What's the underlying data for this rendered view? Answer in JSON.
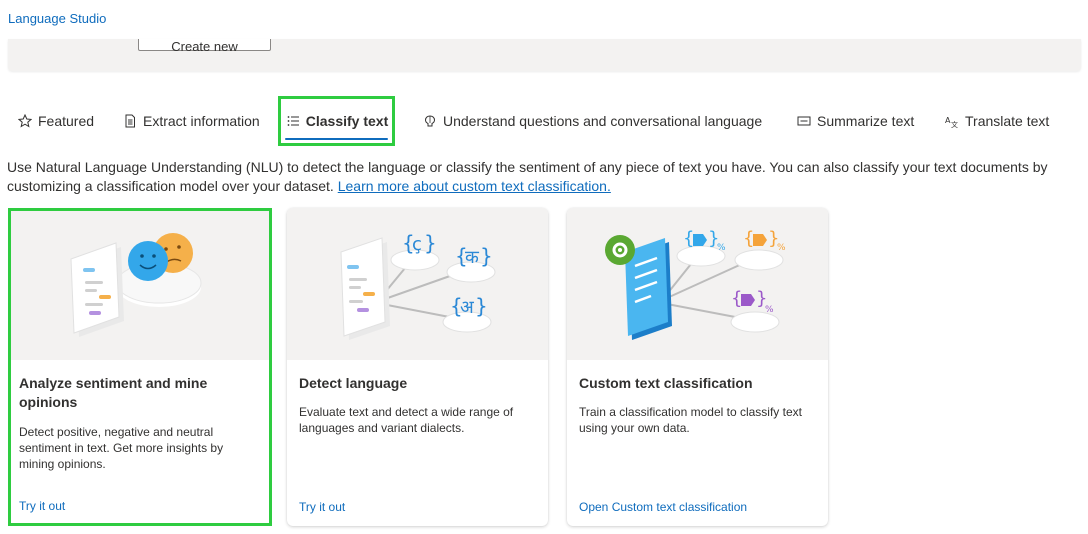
{
  "app": {
    "title": "Language Studio"
  },
  "top_panel": {
    "create_button": "Create new"
  },
  "tabs": [
    {
      "label": "Featured",
      "icon": "star-icon",
      "selected": false
    },
    {
      "label": "Extract information",
      "icon": "document-icon",
      "selected": false
    },
    {
      "label": "Classify text",
      "icon": "list-icon",
      "selected": true
    },
    {
      "label": "Understand questions and conversational language",
      "icon": "brain-icon",
      "selected": false
    },
    {
      "label": "Summarize text",
      "icon": "text-box-icon",
      "selected": false
    },
    {
      "label": "Translate text",
      "icon": "translate-icon",
      "selected": false
    }
  ],
  "description": {
    "text": "Use Natural Language Understanding (NLU) to detect the language or classify the sentiment of any piece of text you have. You can also classify your text documents by customizing a classification model over your dataset.",
    "link": "Learn more about custom text classification."
  },
  "cards": [
    {
      "title": "Analyze sentiment and mine opinions",
      "description": "Detect positive, negative and neutral sentiment in text. Get more insights by mining opinions.",
      "link": "Try it out",
      "illustration": "sentiment-faces-illustration"
    },
    {
      "title": "Detect language",
      "description": "Evaluate text and detect a wide range of languages and variant dialects.",
      "link": "Try it out",
      "illustration": "language-glyphs-illustration",
      "glyphs": [
        "ç",
        "क",
        "अ"
      ]
    },
    {
      "title": "Custom text classification",
      "description": "Train a classification model to classify text using your own data.",
      "link": "Open Custom text classification",
      "illustration": "custom-classification-illustration"
    }
  ],
  "colors": {
    "accent": "#0f6cbd",
    "highlight": "#2ecc40",
    "panel": "#f3f2f1"
  }
}
